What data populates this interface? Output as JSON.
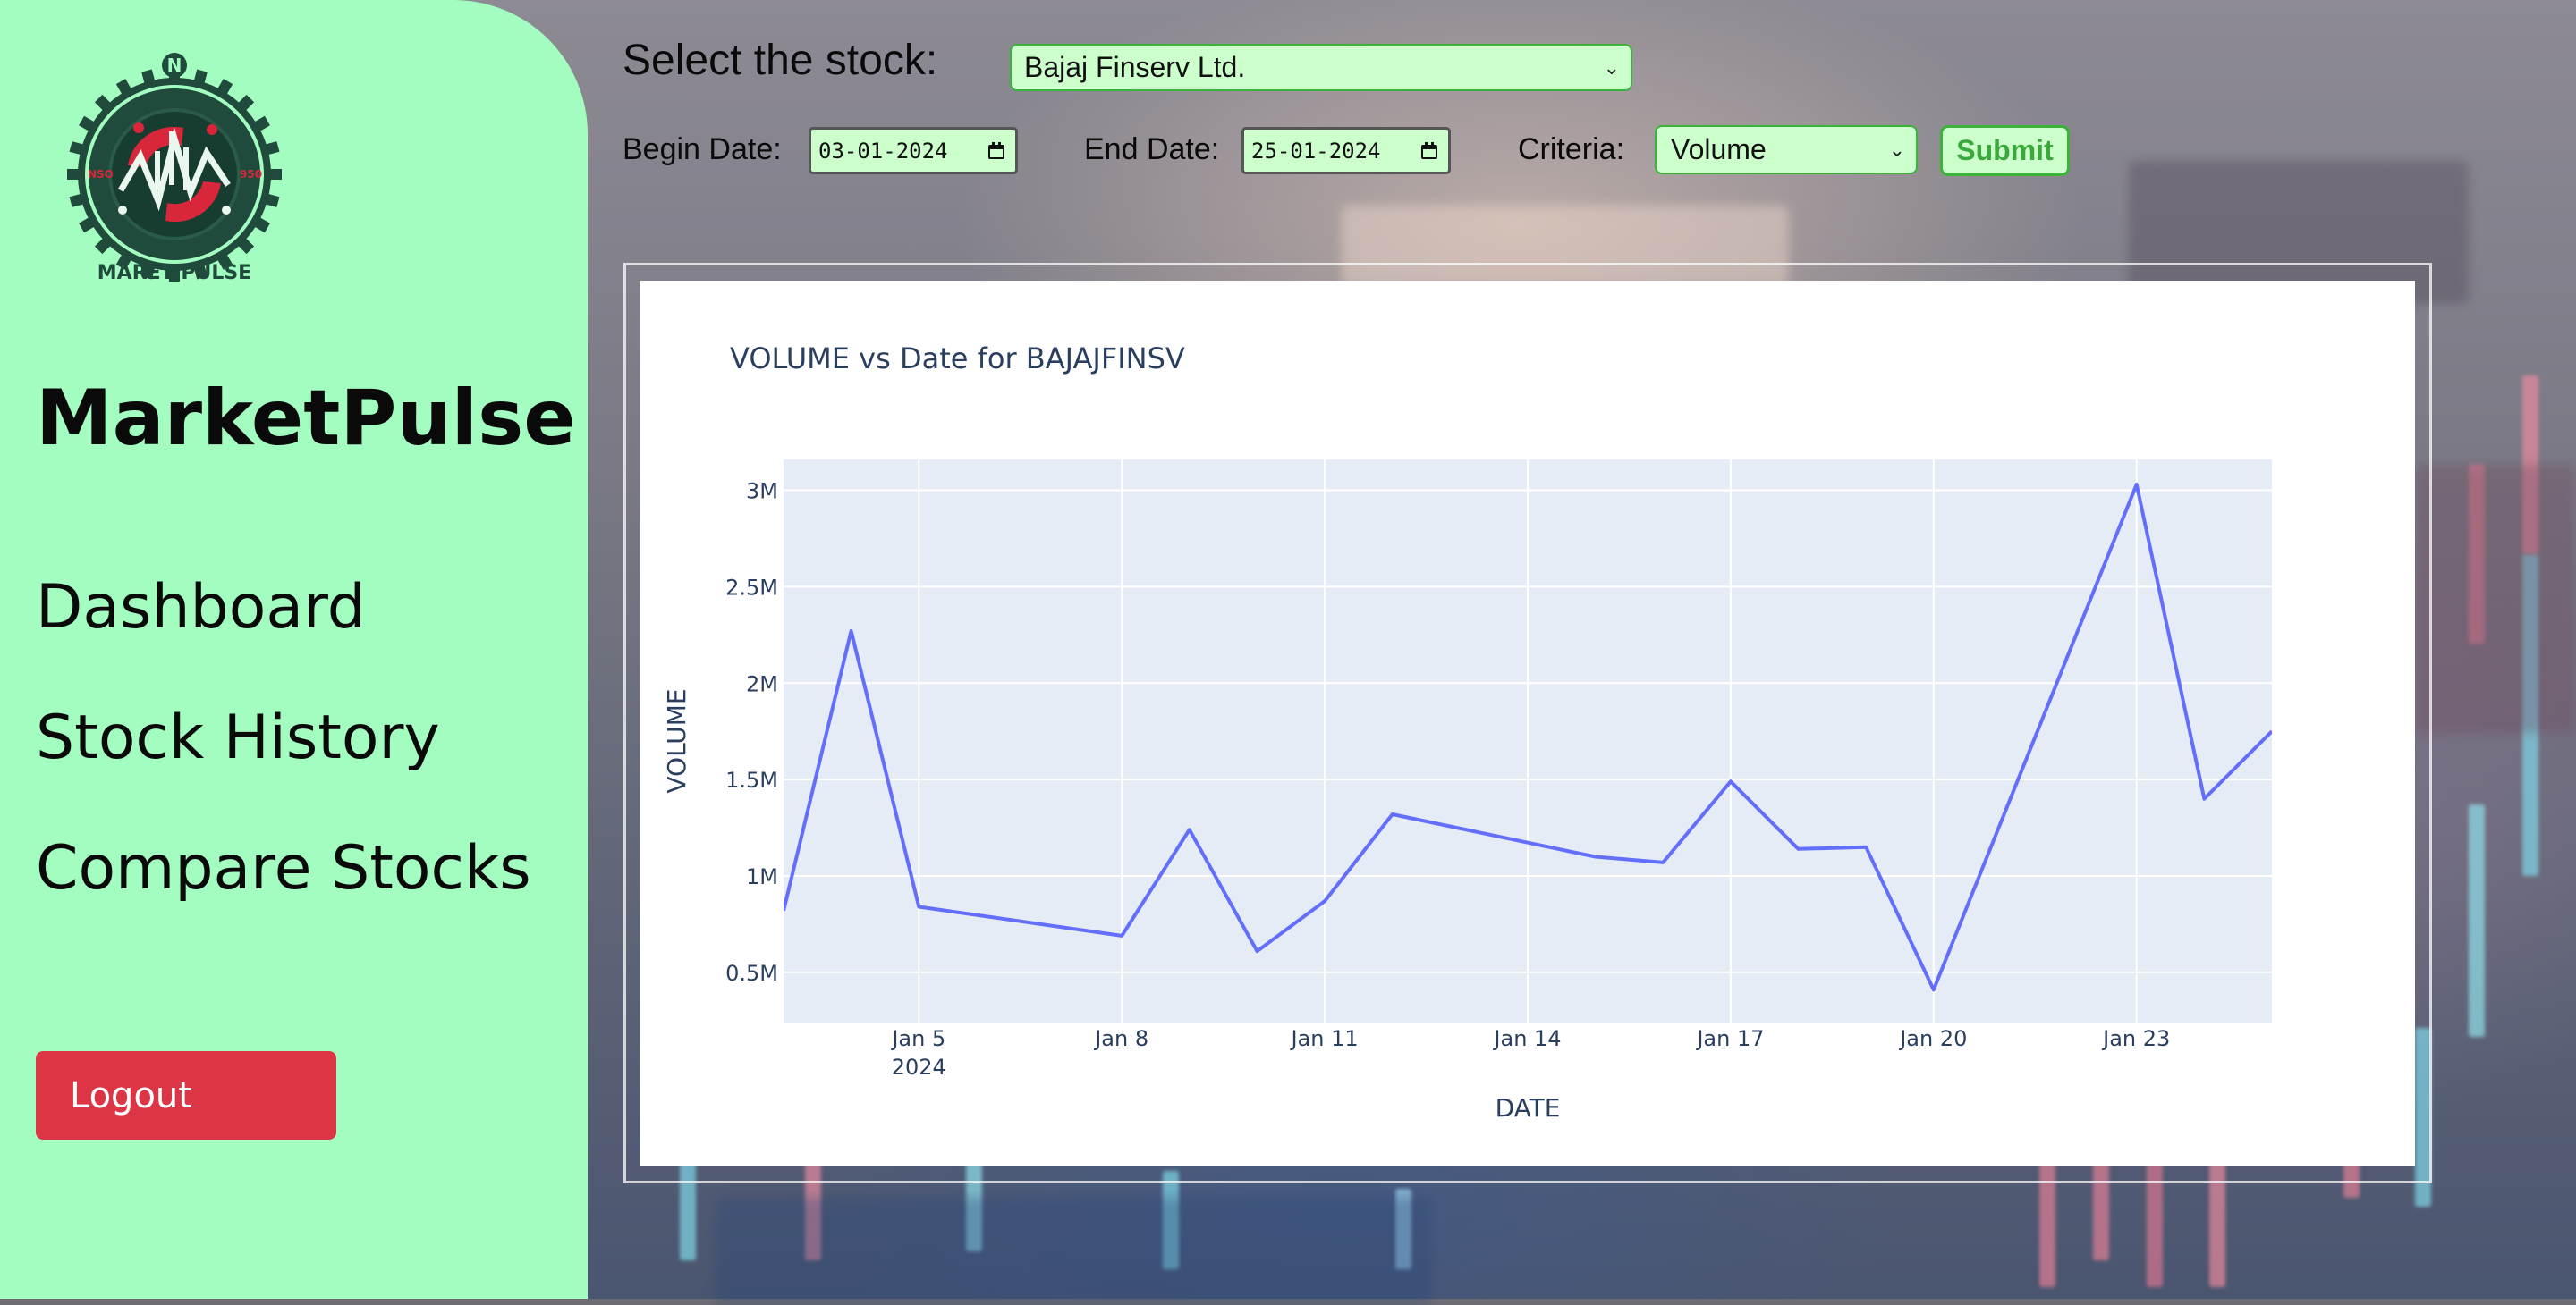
{
  "sidebar": {
    "logo": {
      "text_top": "N",
      "text_bottom": "MARET PULSE",
      "text_left": "NSO",
      "text_right": "950"
    },
    "brand": "MarketPulse",
    "nav": [
      {
        "label": "Dashboard"
      },
      {
        "label": "Stock History"
      },
      {
        "label": "Compare Stocks"
      }
    ],
    "logout_label": "Logout"
  },
  "form": {
    "stock_label": "Select the stock:",
    "stock_value": "Bajaj Finserv Ltd.",
    "begin_label": "Begin Date:",
    "begin_value": "03-01-2024",
    "end_label": "End Date:",
    "end_value": "25-01-2024",
    "criteria_label": "Criteria:",
    "criteria_value": "Volume",
    "submit_label": "Submit"
  },
  "chart_data": {
    "type": "line",
    "title": "VOLUME vs Date for BAJAJFINSV",
    "xlabel": "DATE",
    "ylabel": "VOLUME",
    "x": [
      "2024-01-03",
      "2024-01-04",
      "2024-01-05",
      "2024-01-08",
      "2024-01-09",
      "2024-01-10",
      "2024-01-11",
      "2024-01-12",
      "2024-01-15",
      "2024-01-16",
      "2024-01-17",
      "2024-01-18",
      "2024-01-19",
      "2024-01-20",
      "2024-01-23",
      "2024-01-24",
      "2024-01-25"
    ],
    "values": [
      820000,
      2270000,
      840000,
      690000,
      1240000,
      610000,
      870000,
      1320000,
      1100000,
      1070000,
      1490000,
      1140000,
      1150000,
      410000,
      3030000,
      1400000,
      1750000
    ],
    "xlim": [
      "2024-01-03",
      "2024-01-25"
    ],
    "ylim": [
      240000,
      3160000
    ],
    "xticks": [
      {
        "date": "2024-01-05",
        "label": "Jan 5",
        "sublabel": "2024"
      },
      {
        "date": "2024-01-08",
        "label": "Jan 8"
      },
      {
        "date": "2024-01-11",
        "label": "Jan 11"
      },
      {
        "date": "2024-01-14",
        "label": "Jan 14"
      },
      {
        "date": "2024-01-17",
        "label": "Jan 17"
      },
      {
        "date": "2024-01-20",
        "label": "Jan 20"
      },
      {
        "date": "2024-01-23",
        "label": "Jan 23"
      }
    ],
    "yticks": [
      {
        "value": 500000,
        "label": "0.5M"
      },
      {
        "value": 1000000,
        "label": "1M"
      },
      {
        "value": 1500000,
        "label": "1.5M"
      },
      {
        "value": 2000000,
        "label": "2M"
      },
      {
        "value": 2500000,
        "label": "2.5M"
      },
      {
        "value": 3000000,
        "label": "3M"
      }
    ],
    "line_color": "#636efa",
    "plot_bg": "#e5ecf6",
    "grid": true,
    "legend": "none"
  },
  "colors": {
    "sidebar_bg": "#a3fcc0",
    "logout_bg": "#dc3545",
    "input_bg": "#ccffcc",
    "input_border": "#3bb33b"
  },
  "icons": {
    "select_chevron": "chevron-down-icon",
    "date_picker": "calendar-icon"
  }
}
